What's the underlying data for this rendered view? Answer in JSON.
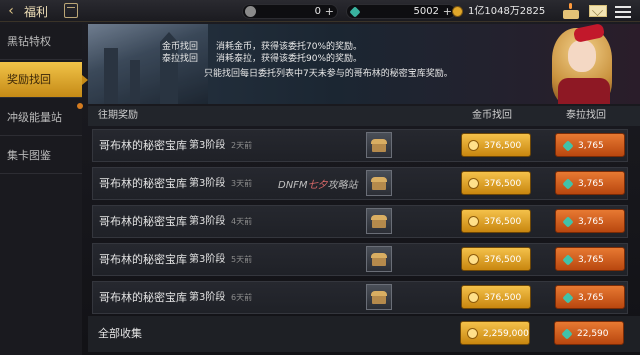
{
  "topbar": {
    "back_icon": "back-arrow-icon",
    "title": "福利",
    "currency1": {
      "icon": "coin-icon",
      "value": "0",
      "plus": "+"
    },
    "currency2": {
      "icon": "gem-icon",
      "value": "5002",
      "plus": "+"
    },
    "gold": {
      "icon": "gold-icon",
      "value": "1亿1048万2825",
      "plus": "+"
    }
  },
  "sidebar": {
    "items": [
      {
        "label": "黑钻特权"
      },
      {
        "label": "奖励找回"
      },
      {
        "label": "冲级能量站"
      },
      {
        "label": "集卡图鉴"
      }
    ]
  },
  "banner": {
    "tag_gold": "金币找回",
    "tag_tera": "泰拉找回",
    "desc_gold": "消耗金币，获得该委托70%的奖励。",
    "desc_tera": "消耗泰拉，获得该委托90%的奖励。",
    "desc_note": "只能找回每日委托列表中7天未参与的哥布林的秘密宝库奖励。"
  },
  "table": {
    "col_reward": "往期奖励",
    "col_gold": "金币找回",
    "col_tera": "泰拉找回",
    "rows": [
      {
        "name": "哥布林的秘密宝库",
        "stage": "第3阶段",
        "days": "2天前",
        "gold": "376,500",
        "tera": "3,765"
      },
      {
        "name": "哥布林的秘密宝库",
        "stage": "第3阶段",
        "days": "3天前",
        "gold": "376,500",
        "tera": "3,765"
      },
      {
        "name": "哥布林的秘密宝库",
        "stage": "第3阶段",
        "days": "4天前",
        "gold": "376,500",
        "tera": "3,765"
      },
      {
        "name": "哥布林的秘密宝库",
        "stage": "第3阶段",
        "days": "5天前",
        "gold": "376,500",
        "tera": "3,765"
      },
      {
        "name": "哥布林的秘密宝库",
        "stage": "第3阶段",
        "days": "6天前",
        "gold": "376,500",
        "tera": "3,765"
      }
    ]
  },
  "total": {
    "label": "全部收集",
    "gold": "2,259,000",
    "tera": "22,590"
  },
  "watermark": {
    "a": "DNFM",
    "b": "七夕",
    "c": "攻略站"
  }
}
